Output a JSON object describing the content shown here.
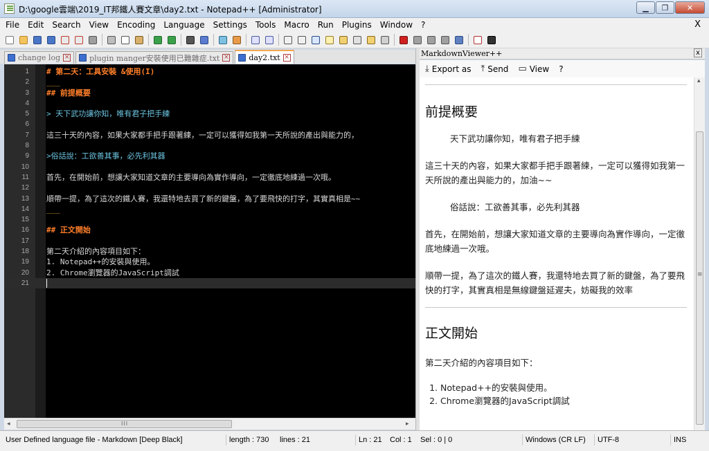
{
  "window": {
    "title": "D:\\google雲端\\2019_IT邦鐵人賽文章\\day2.txt - Notepad++ [Administrator]",
    "minimize": "▁",
    "maximize": "❐",
    "close": "✕"
  },
  "menu": [
    "File",
    "Edit",
    "Search",
    "View",
    "Encoding",
    "Language",
    "Settings",
    "Tools",
    "Macro",
    "Run",
    "Plugins",
    "Window",
    "?"
  ],
  "menu_close": "X",
  "toolbar": {
    "icons": [
      {
        "name": "new-icon",
        "color": "#ffffff",
        "border": "#777777"
      },
      {
        "name": "open-icon",
        "color": "#f3c45b",
        "border": "#b8862a"
      },
      {
        "name": "save-icon",
        "color": "#4a76c7",
        "border": "#2b4a87"
      },
      {
        "name": "save-all-icon",
        "color": "#4a76c7",
        "border": "#2b4a87"
      },
      {
        "name": "close-icon",
        "color": "#e9e9e9",
        "border": "#c0392b"
      },
      {
        "name": "close-all-icon",
        "color": "#e9e9e9",
        "border": "#c0392b"
      },
      {
        "name": "print-icon",
        "color": "#9e9e9e",
        "border": "#555555"
      },
      "sep",
      {
        "name": "cut-icon",
        "color": "#bdbdbd",
        "border": "#555555"
      },
      {
        "name": "copy-icon",
        "color": "#ffffff",
        "border": "#555555"
      },
      {
        "name": "paste-icon",
        "color": "#d8b06a",
        "border": "#7a5a20"
      },
      "sep",
      {
        "name": "undo-icon",
        "color": "#3aa14a",
        "border": "#206a2a"
      },
      {
        "name": "redo-icon",
        "color": "#3aa14a",
        "border": "#206a2a"
      },
      "sep",
      {
        "name": "find-icon",
        "color": "#555555",
        "border": "#222222"
      },
      {
        "name": "replace-icon",
        "color": "#5a7bd0",
        "border": "#2b4a87"
      },
      "sep",
      {
        "name": "zoom-in-icon",
        "color": "#7ec0e0",
        "border": "#2a6a8a"
      },
      {
        "name": "zoom-out-icon",
        "color": "#e89a4a",
        "border": "#8a5a20"
      },
      "sep",
      {
        "name": "sync-vertical-icon",
        "color": "#e0e0ff",
        "border": "#4a5aa0"
      },
      {
        "name": "sync-horizontal-icon",
        "color": "#e0e0ff",
        "border": "#4a5aa0"
      },
      "sep",
      {
        "name": "word-wrap-icon",
        "color": "#f0f0f0",
        "border": "#555555"
      },
      {
        "name": "all-chars-icon",
        "color": "#f0f0f0",
        "border": "#555555"
      },
      {
        "name": "indent-guide-icon",
        "color": "#d8e6ff",
        "border": "#2b4a87"
      },
      {
        "name": "udl-icon",
        "color": "#fff2b0",
        "border": "#9a7a20"
      },
      {
        "name": "doc-map-icon",
        "color": "#f0d070",
        "border": "#8a6a20"
      },
      {
        "name": "function-list-icon",
        "color": "#e0e0e0",
        "border": "#555555"
      },
      {
        "name": "folder-workspace-icon",
        "color": "#f0d070",
        "border": "#8a6a20"
      },
      {
        "name": "monitor-icon",
        "color": "#d0d0d0",
        "border": "#555555"
      },
      "sep",
      {
        "name": "record-macro-icon",
        "color": "#d02020",
        "border": "#701010"
      },
      {
        "name": "stop-macro-icon",
        "color": "#a0a0a0",
        "border": "#555555"
      },
      {
        "name": "play-macro-icon",
        "color": "#a0a0a0",
        "border": "#555555"
      },
      {
        "name": "play-multiple-icon",
        "color": "#a0a0a0",
        "border": "#555555"
      },
      {
        "name": "save-macro-icon",
        "color": "#6080c0",
        "border": "#2b4a87"
      },
      "sep",
      {
        "name": "spell-check-icon",
        "color": "#ffffff",
        "border": "#b03030"
      },
      {
        "name": "markdown-viewer-icon",
        "color": "#333333",
        "border": "#000000"
      }
    ]
  },
  "tabs": [
    {
      "label": "change log",
      "active": false
    },
    {
      "label": "plugin manger安裝使用已難雜症.txt",
      "active": false
    },
    {
      "label": "day2.txt",
      "active": true
    }
  ],
  "editor": {
    "lines": [
      {
        "n": "1",
        "text": "# 第二天：工具安裝 &使用(I)",
        "type": "h1"
      },
      {
        "n": "2",
        "text": "___",
        "type": "rule"
      },
      {
        "n": "3",
        "text": "## 前提概要",
        "type": "h2"
      },
      {
        "n": "4",
        "text": "",
        "type": "plain"
      },
      {
        "n": "5",
        "text": "> 天下武功讓你知，唯有君子把手練",
        "type": "quote"
      },
      {
        "n": "6",
        "text": "",
        "type": "plain"
      },
      {
        "n": "7",
        "text": "這三十天的內容，如果大家都手把手跟著練，一定可以獲得如我第一天所說的產出與能力的，",
        "type": "plain"
      },
      {
        "n": "8",
        "text": "",
        "type": "plain"
      },
      {
        "n": "9",
        "text": ">俗話說：工欲善其事，必先利其器",
        "type": "quote"
      },
      {
        "n": "10",
        "text": "",
        "type": "plain"
      },
      {
        "n": "11",
        "text": "首先，在開始前，想讓大家知道文章的主要導向為實作導向，一定徹底地練過一次哦。",
        "type": "plain"
      },
      {
        "n": "12",
        "text": "",
        "type": "plain"
      },
      {
        "n": "13",
        "text": "順帶一提，為了這次的鐵人賽，我還特地去買了新的鍵盤，為了要飛快的打字，其實真相是~~",
        "type": "plain"
      },
      {
        "n": "14",
        "text": "___",
        "type": "rule"
      },
      {
        "n": "15",
        "text": "",
        "type": "plain"
      },
      {
        "n": "16",
        "text": "## 正文開始",
        "type": "h2"
      },
      {
        "n": "17",
        "text": "",
        "type": "plain"
      },
      {
        "n": "18",
        "text": "第二天介紹的內容項目如下：",
        "type": "plain"
      },
      {
        "n": "19",
        "text": "1. Notepad++的安裝與使用。",
        "type": "plain"
      },
      {
        "n": "20",
        "text": "2. Chrome瀏覽器的JavaScript調試",
        "type": "plain"
      },
      {
        "n": "21",
        "text": "",
        "type": "cur"
      }
    ]
  },
  "hscroll": {
    "left": "◂",
    "right": "▸",
    "grip": "III"
  },
  "markdown_viewer": {
    "panel_title": "MarkdownViewer++",
    "close": "x",
    "toolbar": [
      {
        "name": "export-as-button",
        "icon": "download-icon",
        "glyph": "⤓",
        "label": "Export as"
      },
      {
        "name": "send-button",
        "icon": "upload-icon",
        "glyph": "⤒",
        "label": "Send"
      },
      {
        "name": "view-button",
        "icon": "monitor-icon",
        "glyph": "▭",
        "label": "View"
      },
      {
        "name": "help-button",
        "icon": "",
        "glyph": "",
        "label": "?"
      }
    ],
    "content": {
      "h2_1": "前提概要",
      "quote1": "天下武功讓你知，唯有君子把手練",
      "p1": "這三十天的內容，如果大家都手把手跟著練，一定可以獲得如我第一天所說的產出與能力的，加油~~",
      "quote2": "俗話說：工欲善其事，必先利其器",
      "p2": "首先，在開始前，想讓大家知道文章的主要導向為實作導向，一定徹底地練過一次哦。",
      "p3": "順帶一提，為了這次的鐵人賽，我還特地去買了新的鍵盤，為了要飛快的打字，其實真相是無線鍵盤延遲夫，妨礙我的效率",
      "h2_2": "正文開始",
      "p4": "第二天介紹的內容項目如下：",
      "list": [
        "Notepad++的安裝與使用。",
        "Chrome瀏覽器的JavaScript調試"
      ]
    }
  },
  "status": {
    "language": "User Defined language file - Markdown [Deep Black]",
    "length": "length : 730",
    "lines": "lines : 21",
    "ln": "Ln : 21",
    "col": "Col : 1",
    "sel": "Sel : 0 | 0",
    "eol": "Windows (CR LF)",
    "encoding": "UTF-8",
    "mode": "INS"
  }
}
